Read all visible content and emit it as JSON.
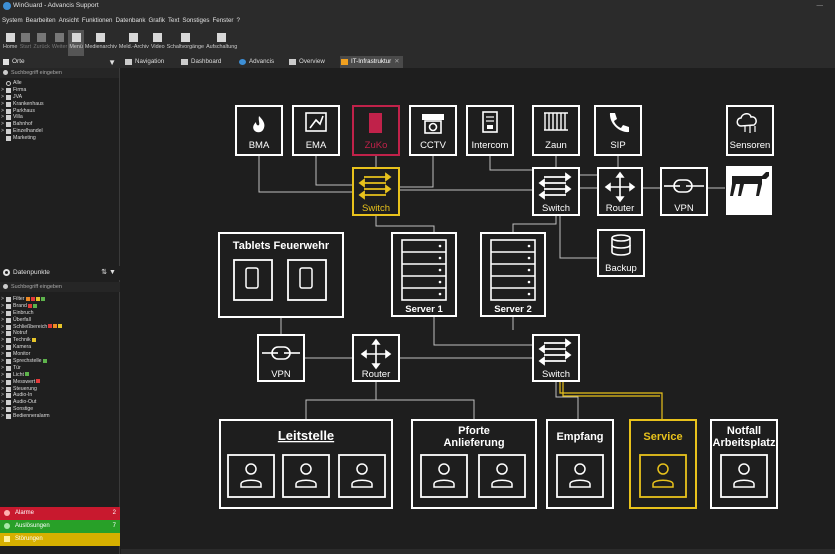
{
  "window": {
    "title": "WinGuard - Advancis Support"
  },
  "menubar": {
    "items": [
      "System",
      "Bearbeiten",
      "Ansicht",
      "Funktionen",
      "Datenbank",
      "Grafik",
      "Text",
      "Sonstiges",
      "Fenster",
      "?"
    ]
  },
  "toolbar": {
    "items": [
      "Home",
      "Start",
      "Zurück",
      "Weiter",
      "Menü",
      "Medienarchiv",
      "Meld.-Archiv",
      "Video",
      "Schaltvorgänge",
      "Aufschaltung"
    ]
  },
  "tabs": {
    "items": [
      "Navigation",
      "Dashboard",
      "Advancis",
      "Overview",
      "IT-Infrastruktur"
    ]
  },
  "orte": {
    "title": "Orte",
    "search_placeholder": "Suchbegriff eingeben",
    "items": [
      "Alle",
      "Firma",
      "JVA",
      "Krankenhaus",
      "Parkhaus",
      "Villa",
      "Bahnhof",
      "Einzelhandel",
      "Marketing"
    ]
  },
  "datenpunkte": {
    "title": "Datenpunkte",
    "search_placeholder": "Suchbegriff eingeben",
    "items": [
      "Filter",
      "Brand",
      "Einbruch",
      "Überfall",
      "Schließbereich",
      "Notruf",
      "Technik",
      "Kamera",
      "Monitor",
      "Sprechstelle",
      "Tür",
      "Licht",
      "Messwert",
      "Steuerung",
      "Audio-In",
      "Audio-Out",
      "Sonstige",
      "Bedienneralarm"
    ]
  },
  "status": {
    "alarme": {
      "label": "Alarme",
      "count": "2"
    },
    "ausloesungen": {
      "label": "Auslösungen",
      "count": "7"
    },
    "stoerungen": {
      "label": "Störungen",
      "count": ""
    }
  },
  "diagram": {
    "devices": [
      "BMA",
      "EMA",
      "ZuKo",
      "CCTV",
      "Intercom",
      "Zaun",
      "SIP",
      "Sensoren"
    ],
    "switch_top_left": "Switch",
    "switch_top_right": "Switch",
    "router_top": "Router",
    "vpn_top": "VPN",
    "backup": "Backup",
    "tablets_title": "Tablets Feuerwehr",
    "server1": "Server 1",
    "server2": "Server 2",
    "vpn_mid": "VPN",
    "router_mid": "Router",
    "switch_mid": "Switch",
    "leitstelle": "Leitstelle",
    "pforte_line1": "Pforte",
    "pforte_line2": "Anlieferung",
    "empfang": "Empfang",
    "service": "Service",
    "notfall_line1": "Notfall",
    "notfall_line2": "Arbeitsplatz"
  },
  "colors": {
    "accent_yellow": "#e8c21c",
    "zuko_red": "#c0224a",
    "line": "#bfbfbf"
  }
}
